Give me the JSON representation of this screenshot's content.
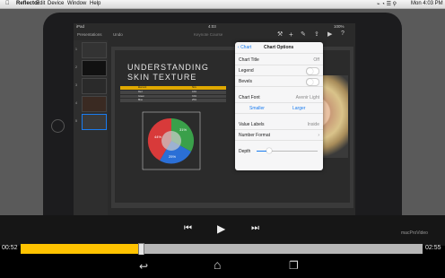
{
  "menubar": {
    "apple": "",
    "items": [
      "Reflector",
      "Edit",
      "Device",
      "Window",
      "Help"
    ],
    "clock": "Mon 4:03 PM"
  },
  "ipad_status": {
    "carrier": "iPad",
    "time": "4:03",
    "battery": "100%"
  },
  "keynote_toolbar": {
    "presentations": "Presentations",
    "undo": "Undo",
    "doc_title": "Keynote Course"
  },
  "thumbnails": [
    "1",
    "2",
    "3",
    "4",
    "5"
  ],
  "slide": {
    "title_line1": "UNDERSTANDING",
    "title_line2": "SKIN TEXTURE",
    "table_headers": [
      "Element",
      "Size"
    ],
    "table_rows": [
      [
        "Red",
        "44%"
      ],
      [
        "Green",
        "31%"
      ],
      [
        "Blue",
        "25%"
      ]
    ],
    "pie_labels": [
      "31%",
      "44%",
      "25%"
    ]
  },
  "popover": {
    "back": "Chart",
    "title": "Chart Options",
    "chart_title_label": "Chart Title",
    "chart_title_value": "Off",
    "legend_label": "Legend",
    "bevels_label": "Bevels",
    "chart_font_label": "Chart Font",
    "chart_font_value": "Avenir Light",
    "smaller": "Smaller",
    "larger": "Larger",
    "value_labels_label": "Value Labels",
    "value_labels_value": "Inside",
    "number_format_label": "Number Format",
    "depth_label": "Depth",
    "depth_fraction": 0.2
  },
  "video": {
    "time_elapsed": "00:52",
    "time_total": "02:55",
    "progress_fraction": 0.3,
    "logo": "macProVideo"
  },
  "colors": {
    "progress": "#ffc300",
    "accent": "#1a7cf0"
  }
}
